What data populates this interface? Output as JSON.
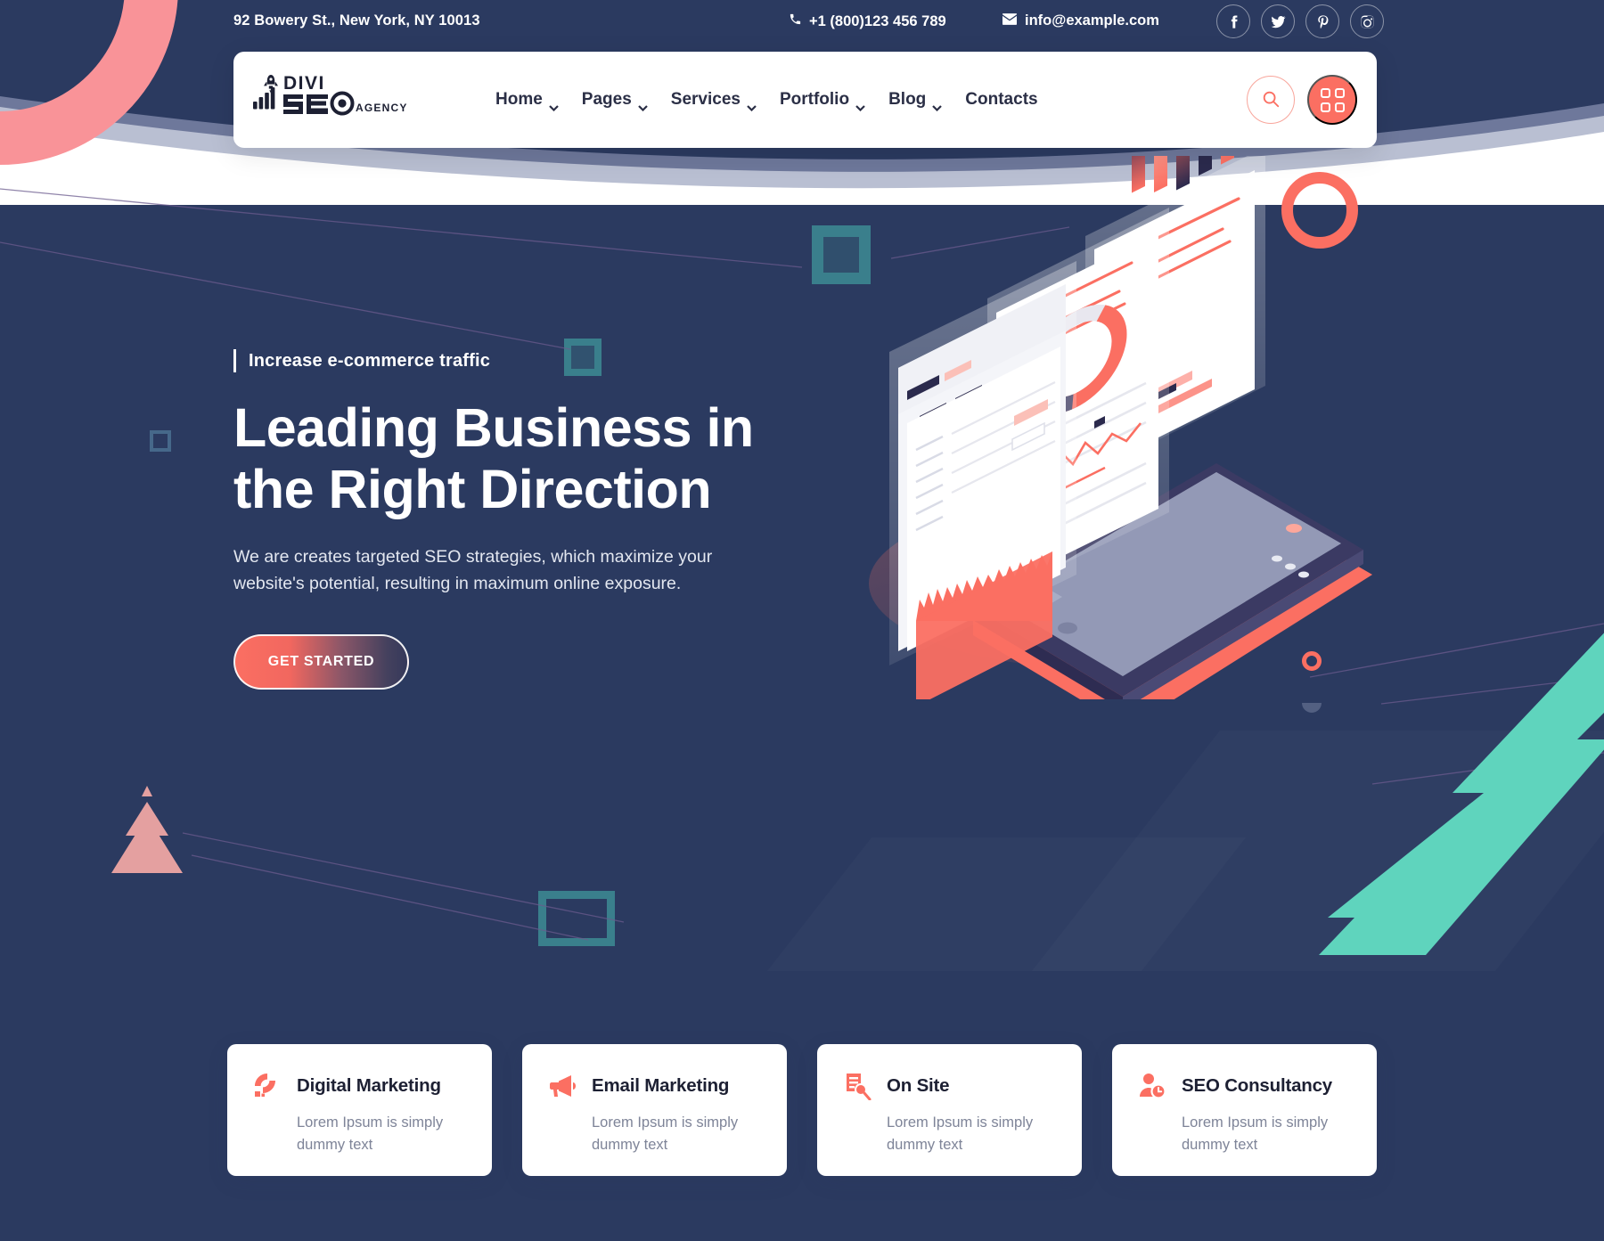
{
  "topbar": {
    "address": "92 Bowery St., New York, NY 10013",
    "phone": "+1 (800)123 456 789",
    "email": "info@example.com",
    "social": [
      {
        "name": "facebook",
        "label": "Facebook"
      },
      {
        "name": "twitter",
        "label": "Twitter"
      },
      {
        "name": "pinterest",
        "label": "Pinterest"
      },
      {
        "name": "instagram",
        "label": "Instagram"
      }
    ]
  },
  "header": {
    "logo": {
      "line1": "DIVI",
      "line2": "SEO",
      "line3": "AGENCY"
    },
    "nav": [
      {
        "label": "Home",
        "has_dropdown": true
      },
      {
        "label": "Pages",
        "has_dropdown": true
      },
      {
        "label": "Services",
        "has_dropdown": true
      },
      {
        "label": "Portfolio",
        "has_dropdown": true
      },
      {
        "label": "Blog",
        "has_dropdown": true
      },
      {
        "label": "Contacts",
        "has_dropdown": false
      }
    ],
    "search_icon": "search-icon",
    "grid_icon": "grid-menu-icon"
  },
  "hero": {
    "eyebrow": "Increase e-commerce traffic",
    "title_line1": "Leading Business in",
    "title_line2": "the Right Direction",
    "subtitle": "We are creates targeted SEO strategies, which maximize your website's potential, resulting in maximum online exposure.",
    "cta_label": "GET STARTED"
  },
  "cards": [
    {
      "icon": "digital-marketing-icon",
      "title": "Digital Marketing",
      "text": "Lorem Ipsum is simply dummy text"
    },
    {
      "icon": "megaphone-icon",
      "title": "Email Marketing",
      "text": "Lorem Ipsum is simply dummy text"
    },
    {
      "icon": "document-search-icon",
      "title": "On Site",
      "text": "Lorem Ipsum is simply dummy text"
    },
    {
      "icon": "user-clock-icon",
      "title": "SEO Consultancy",
      "text": "Lorem Ipsum is simply dummy text"
    }
  ],
  "colors": {
    "background_navy": "#2b3a60",
    "accent_coral": "#fb6f62",
    "accent_pink": "#f99398",
    "accent_teal": "#5fd4bd",
    "accent_square_teal": "#3a7f8c",
    "card_background": "#ffffff",
    "text_dark": "#1d2033",
    "text_muted": "#7e8498"
  }
}
